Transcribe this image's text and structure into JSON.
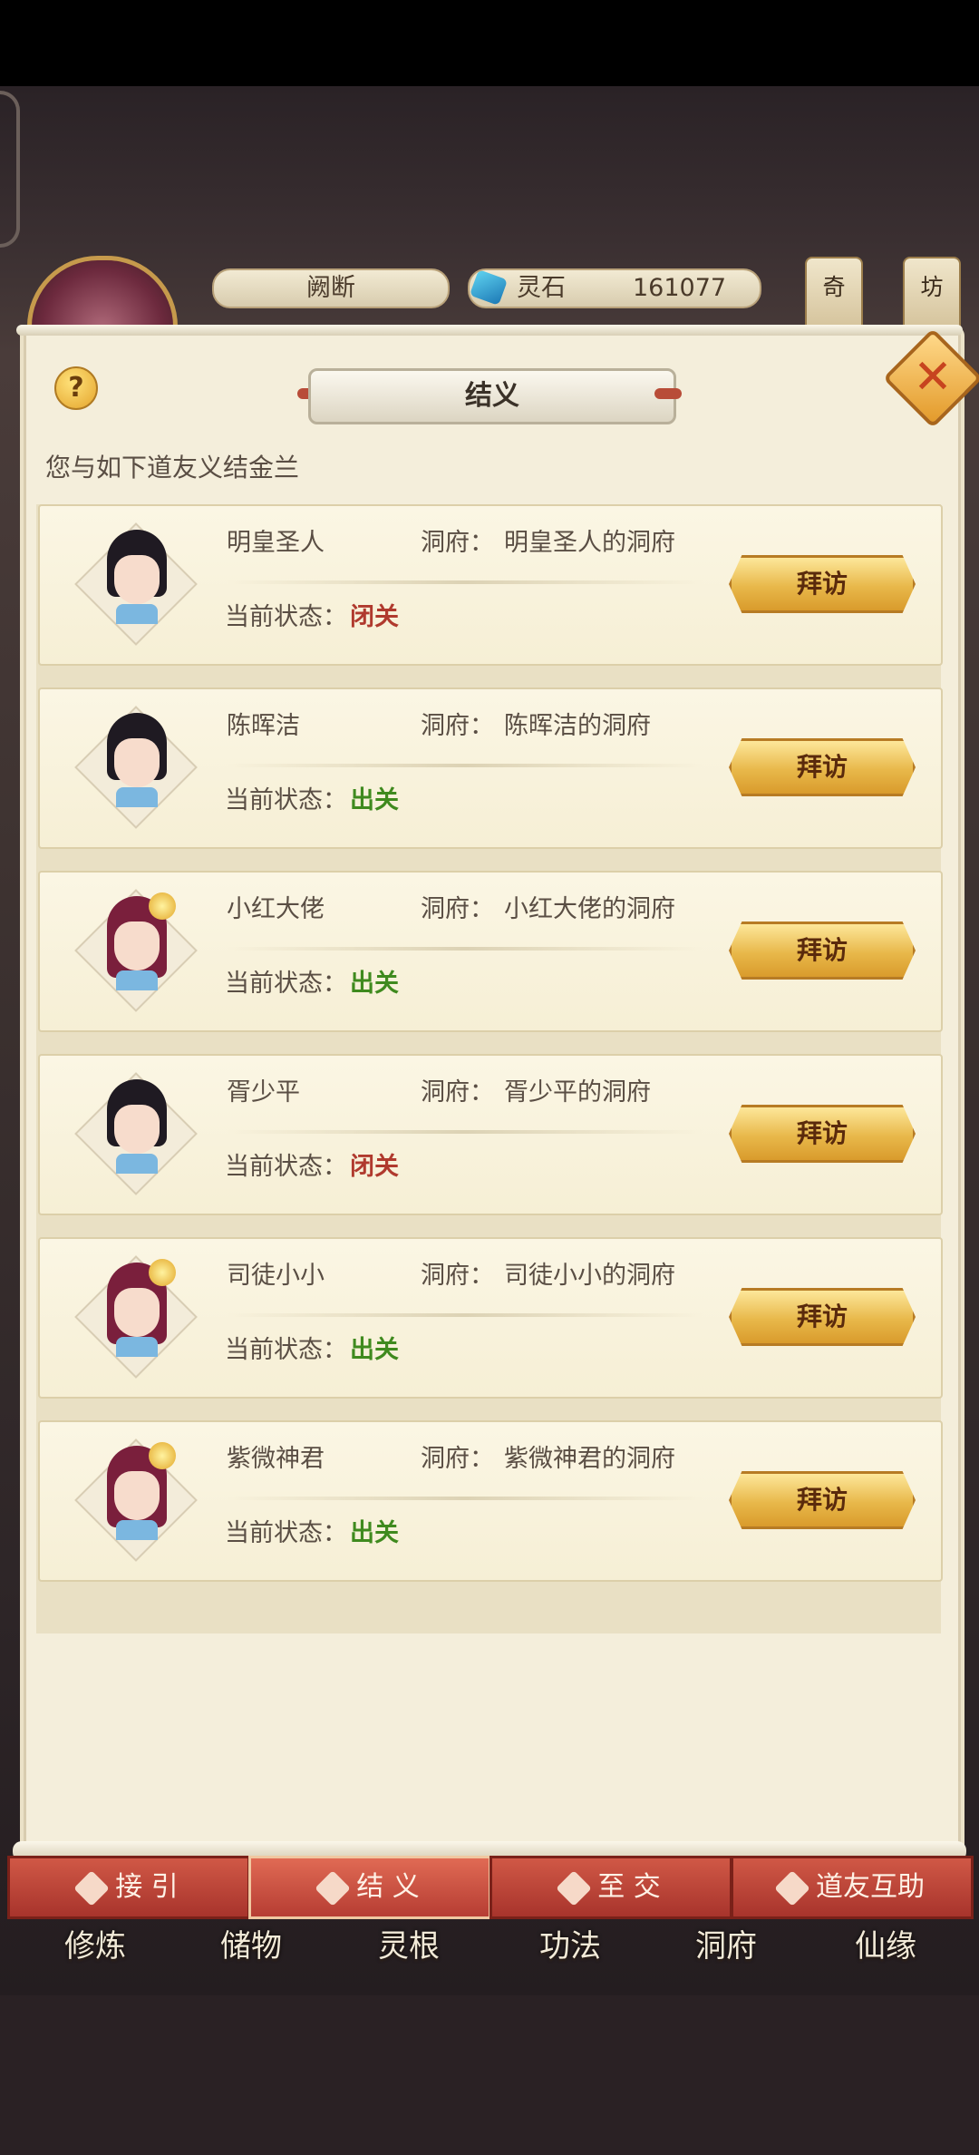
{
  "hud": {
    "player_name": "阙断",
    "currency_label": "灵石",
    "currency_value": "161077",
    "side_buttons": [
      "奇",
      "坊"
    ]
  },
  "panel": {
    "title": "结义",
    "subtitle": "您与如下道友义结金兰",
    "help_icon_text": "?",
    "close_icon_text": "✕"
  },
  "friends": [
    {
      "name": "明皇圣人",
      "home_label": "洞府：",
      "home": "明皇圣人的洞府",
      "status_label": "当前状态：",
      "status": "闭关",
      "status_color": "#b03a2e",
      "avatar": "male",
      "action": "拜访"
    },
    {
      "name": "陈晖洁",
      "home_label": "洞府：",
      "home": "陈晖洁的洞府",
      "status_label": "当前状态：",
      "status": "出关",
      "status_color": "#3f8a1e",
      "avatar": "male",
      "action": "拜访"
    },
    {
      "name": "小红大佬",
      "home_label": "洞府：",
      "home": "小红大佬的洞府",
      "status_label": "当前状态：",
      "status": "出关",
      "status_color": "#3f8a1e",
      "avatar": "female",
      "action": "拜访"
    },
    {
      "name": "胥少平",
      "home_label": "洞府：",
      "home": "胥少平的洞府",
      "status_label": "当前状态：",
      "status": "闭关",
      "status_color": "#b03a2e",
      "avatar": "male",
      "action": "拜访"
    },
    {
      "name": "司徒小小",
      "home_label": "洞府：",
      "home": "司徒小小的洞府",
      "status_label": "当前状态：",
      "status": "出关",
      "status_color": "#3f8a1e",
      "avatar": "female",
      "action": "拜访"
    },
    {
      "name": "紫微神君",
      "home_label": "洞府：",
      "home": "紫微神君的洞府",
      "status_label": "当前状态：",
      "status": "出关",
      "status_color": "#3f8a1e",
      "avatar": "female",
      "action": "拜访"
    }
  ],
  "tabs": [
    {
      "label": "接 引",
      "active": false
    },
    {
      "label": "结 义",
      "active": true
    },
    {
      "label": "至 交",
      "active": false
    },
    {
      "label": "道友互助",
      "active": false
    }
  ],
  "bottom_nav": [
    "修炼",
    "储物",
    "灵根",
    "功法",
    "洞府",
    "仙缘"
  ]
}
